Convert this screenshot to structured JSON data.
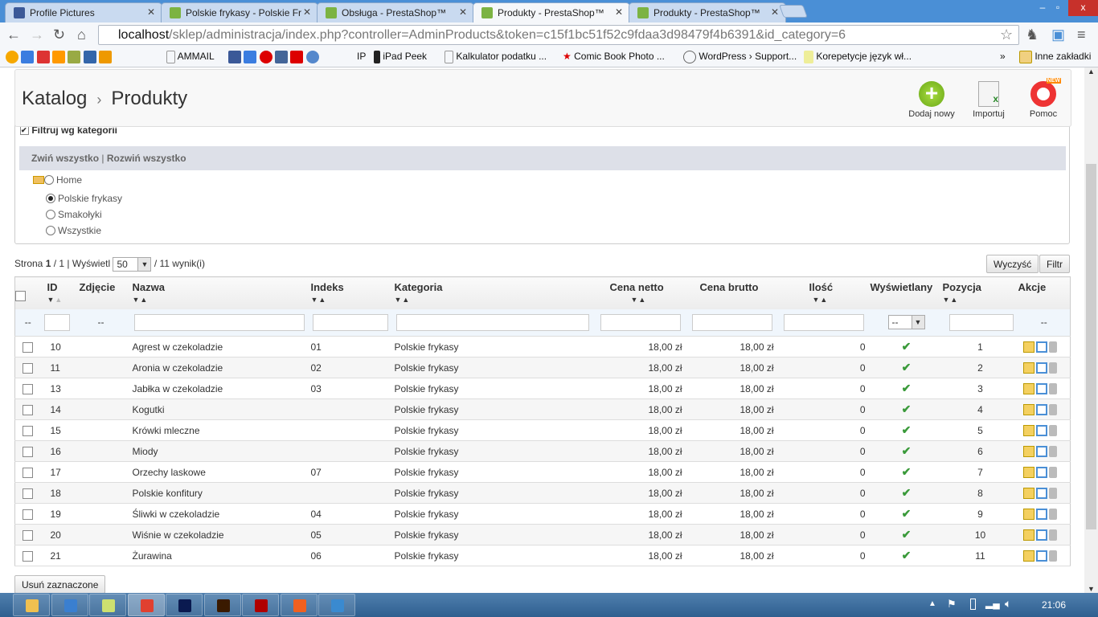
{
  "browser": {
    "tabs": [
      {
        "label": "Profile Pictures",
        "color": "#3b5998"
      },
      {
        "label": "Polskie frykasy - Polskie Fr",
        "color": "#7cb342"
      },
      {
        "label": "Obsługa - PrestaShop™",
        "color": "#7cb342"
      },
      {
        "label": "Produkty - PrestaShop™",
        "color": "#7cb342",
        "active": true
      },
      {
        "label": "Produkty - PrestaShop™",
        "color": "#7cb342"
      }
    ],
    "url_host": "localhost",
    "url_path": "/sklep/administracja/index.php?controller=AdminProducts&token=c15f1bc51f52c9fdaa3d98479f4b6391&id_category=6",
    "bookmarks": [
      "AMMAIL",
      "IP",
      "iPad Peek",
      "Kalkulator podatku ...",
      "Comic Book Photo ...",
      "WordPress › Support...",
      "Korepetycje język wł..."
    ],
    "other_bookmarks": "Inne zakładki"
  },
  "header": {
    "crumb1": "Katalog",
    "crumb2": "Produkty",
    "add": "Dodaj nowy",
    "import": "Importuj",
    "help": "Pomoc",
    "new_badge": "NEW"
  },
  "category": {
    "filter_label": "Filtruj wg kategorii",
    "collapse": "Zwiń wszystko",
    "expand": "Rozwiń wszystko",
    "tree": [
      {
        "label": "Home",
        "selected": false
      },
      {
        "label": "Polskie frykasy",
        "selected": true
      },
      {
        "label": "Smakołyki",
        "selected": false
      },
      {
        "label": "Wszystkie",
        "selected": false
      }
    ]
  },
  "pagination": {
    "page_label": "Strona",
    "page": "1",
    "pages": "1",
    "show_label": "Wyświetl",
    "per_page": "50",
    "results": "/ 11 wynik(i)"
  },
  "buttons": {
    "clear": "Wyczyść",
    "filter": "Filtr",
    "delete_selected": "Usuń zaznaczone"
  },
  "table": {
    "columns": [
      "ID",
      "Zdjęcie",
      "Nazwa",
      "Indeks",
      "Kategoria",
      "Cena netto",
      "Cena brutto",
      "Ilość",
      "Wyświetlany",
      "Pozycja",
      "Akcje"
    ],
    "filter_dash": "--",
    "filter_select": "--",
    "rows": [
      [
        "10",
        "Agrest w czekoladzie",
        "01",
        "Polskie frykasy",
        "18,00 zł",
        "18,00 zł",
        "0",
        "1"
      ],
      [
        "11",
        "Aronia w czekoladzie",
        "02",
        "Polskie frykasy",
        "18,00 zł",
        "18,00 zł",
        "0",
        "2"
      ],
      [
        "13",
        "Jabłka w czekoladzie",
        "03",
        "Polskie frykasy",
        "18,00 zł",
        "18,00 zł",
        "0",
        "3"
      ],
      [
        "14",
        "Kogutki",
        "",
        "Polskie frykasy",
        "18,00 zł",
        "18,00 zł",
        "0",
        "4"
      ],
      [
        "15",
        "Krówki mleczne",
        "",
        "Polskie frykasy",
        "18,00 zł",
        "18,00 zł",
        "0",
        "5"
      ],
      [
        "16",
        "Miody",
        "",
        "Polskie frykasy",
        "18,00 zł",
        "18,00 zł",
        "0",
        "6"
      ],
      [
        "17",
        "Orzechy laskowe",
        "07",
        "Polskie frykasy",
        "18,00 zł",
        "18,00 zł",
        "0",
        "7"
      ],
      [
        "18",
        "Polskie konfitury",
        "",
        "Polskie frykasy",
        "18,00 zł",
        "18,00 zł",
        "0",
        "8"
      ],
      [
        "19",
        "Śliwki w czekoladzie",
        "04",
        "Polskie frykasy",
        "18,00 zł",
        "18,00 zł",
        "0",
        "9"
      ],
      [
        "20",
        "Wiśnie w czekoladzie",
        "05",
        "Polskie frykasy",
        "18,00 zł",
        "18,00 zł",
        "0",
        "10"
      ],
      [
        "21",
        "Żurawina",
        "06",
        "Polskie frykasy",
        "18,00 zł",
        "18,00 zł",
        "0",
        "11"
      ]
    ]
  },
  "taskbar": {
    "clock": "21:06",
    "apps": [
      "explorer",
      "ie",
      "notepad",
      "chrome",
      "photoshop",
      "illustrator",
      "filezilla",
      "xampp",
      "globe"
    ]
  }
}
